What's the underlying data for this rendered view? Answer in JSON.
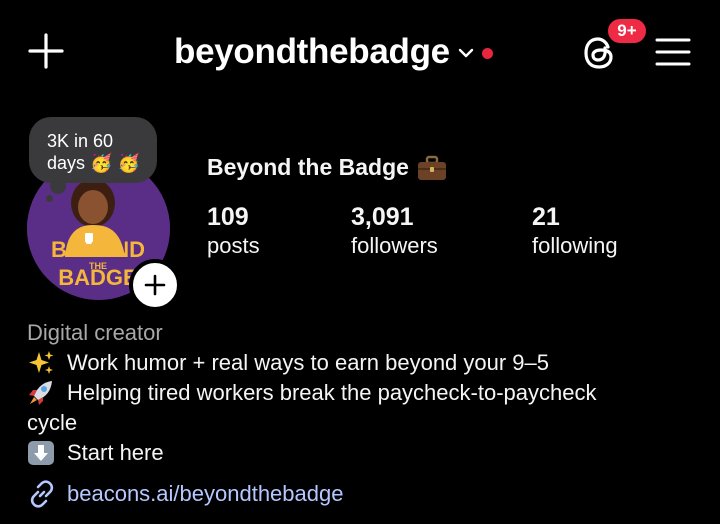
{
  "header": {
    "username": "beyondthebadge",
    "notification_count": "9+",
    "icons": {
      "create": "plus-icon",
      "account_switcher": "chevron-down-icon",
      "live_indicator": "red-dot-icon",
      "threads": "threads-icon",
      "menu": "hamburger-menu-icon"
    }
  },
  "note": {
    "text": "3K in 60 days",
    "emoji": "🥳 🥳"
  },
  "profile": {
    "display_name": "Beyond the Badge",
    "display_name_emoji": "briefcase-icon",
    "avatar_text": [
      "BEYOND",
      "THE",
      "BADGE"
    ],
    "stats": [
      {
        "value": "109",
        "label": "posts"
      },
      {
        "value": "3,091",
        "label": "followers"
      },
      {
        "value": "21",
        "label": "following"
      }
    ]
  },
  "bio": {
    "category": "Digital creator",
    "lines": [
      {
        "icon": "sparkles-icon",
        "text": "Work humor + real ways to earn beyond your 9–5"
      },
      {
        "icon": "rocket-icon",
        "text": "Helping tired workers break the paycheck-to-paycheck",
        "continuation": "cycle"
      },
      {
        "icon": "down-arrow-icon",
        "text": "Start here"
      }
    ],
    "link": "beacons.ai/beyondthebadge"
  },
  "colors": {
    "background": "#000000",
    "badge": "#ee2a45",
    "link": "#b5c7ff",
    "avatar_bg": "#5a2d86",
    "avatar_text": "#f4b63b"
  }
}
